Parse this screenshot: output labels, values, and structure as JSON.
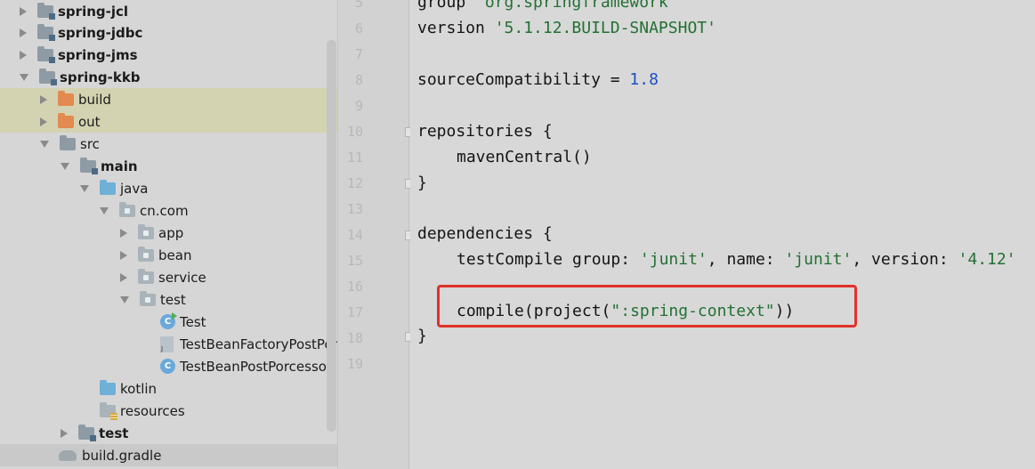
{
  "project_tree": {
    "items": [
      {
        "label": "spring-jcl",
        "arrow": "right",
        "icon": "module-folder",
        "bold": true
      },
      {
        "label": "spring-jdbc",
        "arrow": "right",
        "icon": "module-folder",
        "bold": true
      },
      {
        "label": "spring-jms",
        "arrow": "right",
        "icon": "module-folder",
        "bold": true
      },
      {
        "label": "spring-kkb",
        "arrow": "down",
        "icon": "module-folder",
        "bold": true
      },
      {
        "label": "build",
        "arrow": "right",
        "icon": "excluded-folder"
      },
      {
        "label": "out",
        "arrow": "right",
        "icon": "excluded-folder"
      },
      {
        "label": "src",
        "arrow": "down",
        "icon": "folder"
      },
      {
        "label": "main",
        "arrow": "down",
        "icon": "module-folder",
        "bold": true
      },
      {
        "label": "java",
        "arrow": "down",
        "icon": "source-folder"
      },
      {
        "label": "cn.com",
        "arrow": "down",
        "icon": "package-folder"
      },
      {
        "label": "app",
        "arrow": "right",
        "icon": "package-folder"
      },
      {
        "label": "bean",
        "arrow": "right",
        "icon": "package-folder"
      },
      {
        "label": "service",
        "arrow": "right",
        "icon": "package-folder"
      },
      {
        "label": "test",
        "arrow": "down",
        "icon": "package-folder"
      },
      {
        "label": "Test",
        "arrow": "none",
        "icon": "class-run"
      },
      {
        "label": "TestBeanFactoryPostPor",
        "arrow": "none",
        "icon": "java-file"
      },
      {
        "label": "TestBeanPostPorcessor",
        "arrow": "none",
        "icon": "class"
      },
      {
        "label": "kotlin",
        "arrow": "none",
        "icon": "source-folder"
      },
      {
        "label": "resources",
        "arrow": "none",
        "icon": "resources-folder"
      },
      {
        "label": "test",
        "arrow": "right",
        "icon": "module-folder",
        "bold": true
      },
      {
        "label": "build.gradle",
        "arrow": "none",
        "icon": "gradle-file"
      }
    ]
  },
  "editor": {
    "line_numbers": [
      "5",
      "6",
      "7",
      "8",
      "9",
      "10",
      "11",
      "12",
      "13",
      "14",
      "15",
      "16",
      "17",
      "18",
      "19"
    ],
    "lines": {
      "l5": {
        "kw": "group ",
        "str": "'org.springframework'"
      },
      "l6": {
        "kw": "version ",
        "str": "'5.1.12.BUILD-SNAPSHOT'"
      },
      "l8": {
        "kw": "sourceCompatibility = ",
        "num": "1.8"
      },
      "l10": {
        "text": "repositories {"
      },
      "l11": {
        "text": "mavenCentral()"
      },
      "l12": {
        "text": "}"
      },
      "l14": {
        "text": "dependencies {"
      },
      "l15": {
        "a": "testCompile group: ",
        "s1": "'junit'",
        "b": ", name: ",
        "s2": "'junit'",
        "c": ", version: ",
        "s3": "'4.12'"
      },
      "l17": {
        "a": "compile(project(",
        "s": "\":spring-context\"",
        "b": "))"
      },
      "l18": {
        "text": "}"
      }
    }
  },
  "colors": {
    "highlight_box": "#e0322a",
    "string": "#237033",
    "number": "#1d4fc6"
  }
}
